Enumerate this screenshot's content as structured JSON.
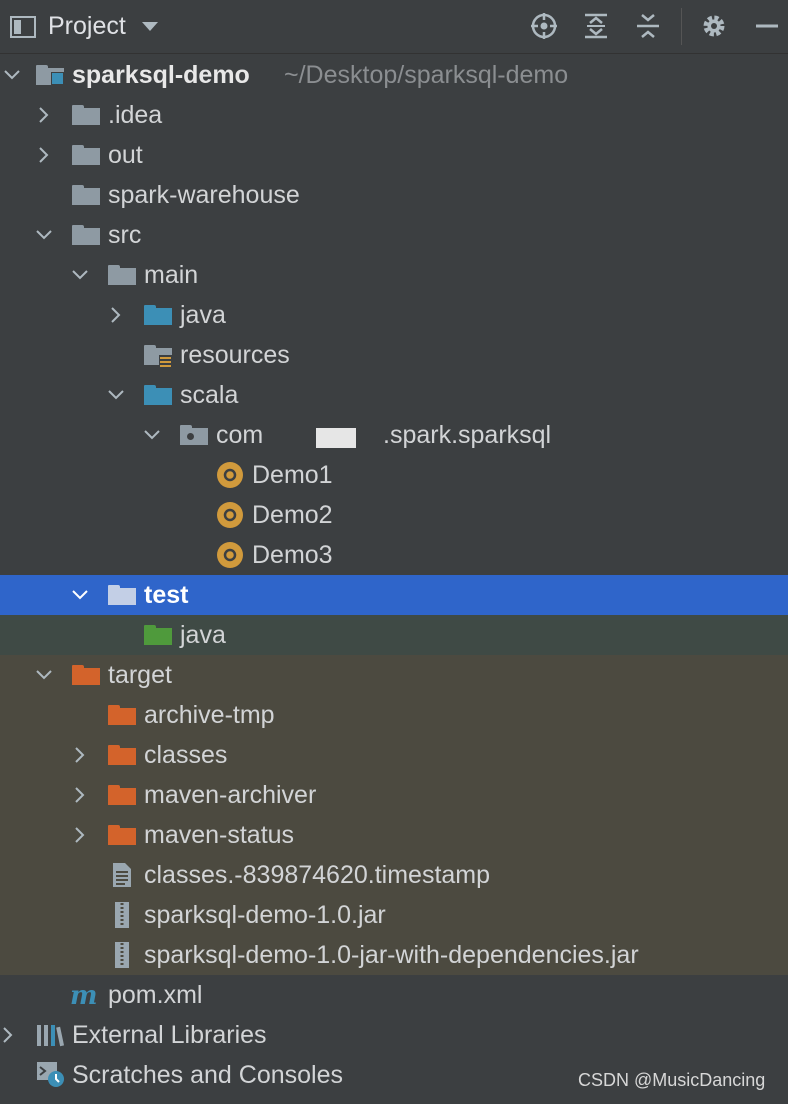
{
  "toolbar": {
    "title": "Project",
    "icons": [
      "project-panel-icon",
      "dropdown-chevron-icon",
      "locate-icon",
      "expand-all-icon",
      "collapse-all-icon",
      "gear-icon",
      "hide-icon"
    ]
  },
  "tree": {
    "root": {
      "name": "sparksql-demo",
      "path": "~/Desktop/sparksql-demo"
    },
    "idea": ".idea",
    "out": "out",
    "spark_warehouse": "spark-warehouse",
    "src": "src",
    "main": "main",
    "java_main": "java",
    "resources": "resources",
    "scala": "scala",
    "package": {
      "prefix": "com",
      "suffix": ".spark.sparksql"
    },
    "demo1": "Demo1",
    "demo2": "Demo2",
    "demo3": "Demo3",
    "test": "test",
    "java_test": "java",
    "target": "target",
    "archive_tmp": "archive-tmp",
    "classes": "classes",
    "maven_archiver": "maven-archiver",
    "maven_status": "maven-status",
    "timestamp_file": "classes.-839874620.timestamp",
    "jar1": "sparksql-demo-1.0.jar",
    "jar2": "sparksql-demo-1.0-jar-with-dependencies.jar",
    "pom": "pom.xml",
    "external_libraries": "External Libraries",
    "scratches": "Scratches and Consoles"
  },
  "colors": {
    "background": "#3c3f41",
    "selection": "#2f65ca",
    "excluded_bg": "#4c4a40",
    "test_bg": "#3f4a45",
    "folder_grey": "#8e9aa3",
    "source_blue": "#3c8fb6",
    "test_green": "#4f9a3c",
    "excluded_orange": "#d3632b",
    "class_gold": "#d19a3c"
  },
  "watermark": "CSDN @MusicDancing"
}
